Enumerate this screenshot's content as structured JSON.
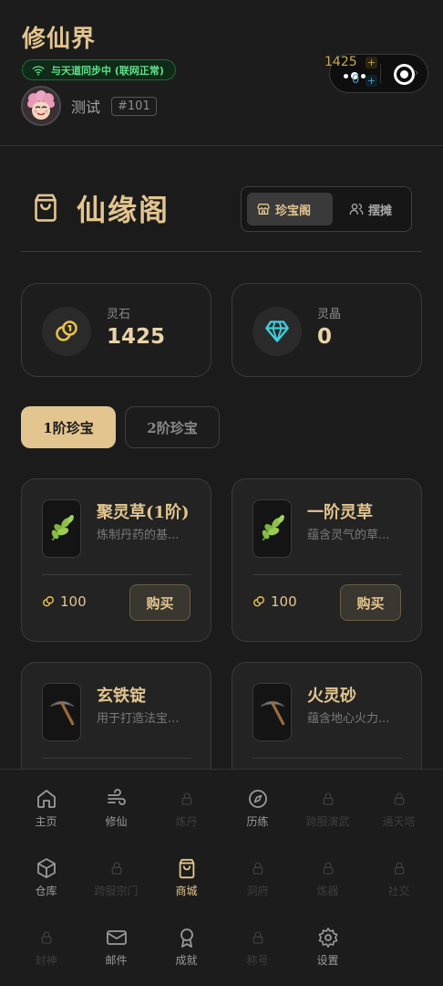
{
  "header": {
    "app_title": "修仙界",
    "sync_status": "与天道同步中 (联网正常)",
    "username": "测试",
    "user_id": "#101",
    "mini_stone": "1425",
    "mini_crystal": "0",
    "plus_label": "+"
  },
  "shop": {
    "title": "仙缘阁",
    "tabs": [
      {
        "label": "珍宝阁",
        "icon": "store-icon",
        "active": true
      },
      {
        "label": "摆摊",
        "icon": "users-icon",
        "active": false
      }
    ]
  },
  "currency": [
    {
      "label": "灵石",
      "value": "1425",
      "icon": "coins-icon",
      "color": "#e9c24a"
    },
    {
      "label": "灵晶",
      "value": "0",
      "icon": "diamond-icon",
      "color": "#3fd0e0"
    }
  ],
  "tiers": [
    {
      "label": "1阶珍宝",
      "active": true
    },
    {
      "label": "2阶珍宝",
      "active": false
    }
  ],
  "items": [
    {
      "name": "聚灵草(1阶)",
      "desc": "炼制丹药的基...",
      "price": "100",
      "buy_label": "购买",
      "icon": "herb-icon"
    },
    {
      "name": "一阶灵草",
      "desc": "蕴含灵气的草...",
      "price": "100",
      "buy_label": "购买",
      "icon": "herb-icon"
    },
    {
      "name": "玄铁锭",
      "desc": "用于打造法宝...",
      "icon": "pickaxe-icon"
    },
    {
      "name": "火灵砂",
      "desc": "蕴含地心火力...",
      "icon": "pickaxe-icon"
    }
  ],
  "nav": [
    {
      "label": "主页",
      "icon": "home-icon",
      "locked": false
    },
    {
      "label": "修仙",
      "icon": "wind-icon",
      "locked": false
    },
    {
      "label": "炼丹",
      "icon": "lock-icon",
      "locked": true
    },
    {
      "label": "历练",
      "icon": "compass-icon",
      "locked": false
    },
    {
      "label": "跨服演武",
      "icon": "lock-icon",
      "locked": true
    },
    {
      "label": "通天塔",
      "icon": "lock-icon",
      "locked": true
    },
    {
      "label": "仓库",
      "icon": "box-icon",
      "locked": false
    },
    {
      "label": "跨服宗门",
      "icon": "lock-icon",
      "locked": true
    },
    {
      "label": "商城",
      "icon": "shopping-bag-icon",
      "locked": false,
      "active": true
    },
    {
      "label": "洞府",
      "icon": "lock-icon",
      "locked": true
    },
    {
      "label": "炼器",
      "icon": "lock-icon",
      "locked": true
    },
    {
      "label": "社交",
      "icon": "lock-icon",
      "locked": true
    },
    {
      "label": "封神",
      "icon": "lock-icon",
      "locked": true
    },
    {
      "label": "邮件",
      "icon": "mail-icon",
      "locked": false
    },
    {
      "label": "成就",
      "icon": "award-icon",
      "locked": false
    },
    {
      "label": "称号",
      "icon": "lock-icon",
      "locked": true
    },
    {
      "label": "设置",
      "icon": "settings-icon",
      "locked": false
    }
  ]
}
